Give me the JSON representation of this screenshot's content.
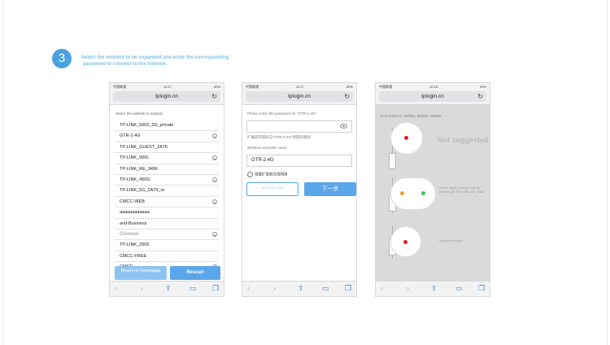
{
  "step": {
    "number": "3",
    "line1": "Select the network to be expanded and enter the corresponding",
    "line2": "password to connect to the internet."
  },
  "colors": {
    "accent": "#4aa3df",
    "button": "#5aa6ea",
    "led_red": "#e02020",
    "led_orange": "#f0a020",
    "led_green": "#3fbf4f"
  },
  "phones": [
    {
      "carrier": "中国联通",
      "time": "10:17",
      "battery": "60%",
      "url": "tplogin.cn",
      "label": "Select the website to expand",
      "networks": [
        {
          "name": "TP-LINK_5600_2G_private",
          "locked": false
        },
        {
          "name": "GTR-2.4G",
          "locked": true
        },
        {
          "name": "TP-LINK_GUEST_2A76",
          "locked": false
        },
        {
          "name": "TP-LINK_900L",
          "locked": true
        },
        {
          "name": "TP-LINK_RE_3456",
          "locked": false
        },
        {
          "name": "TP-LINK_450G",
          "locked": true
        },
        {
          "name": "TP-LINK_5G_2A76_re",
          "locked": false
        },
        {
          "name": "CMCC-WEB",
          "locked": true
        },
        {
          "name": "aaaaaaaaaaaa",
          "locked": false
        },
        {
          "name": "and-Business",
          "locked": false
        },
        {
          "name": "Chinese",
          "locked": true
        },
        {
          "name": "TP-LINK_2606",
          "locked": false
        },
        {
          "name": "CMCC-FREE",
          "locked": false
        },
        {
          "name": "CMCC",
          "locked": true
        }
      ],
      "return_button": "Return to homepage",
      "rescan_button": "Rescan"
    },
    {
      "carrier": "中国联通",
      "time": "10:17",
      "battery": "60%",
      "url": "tplogin.cn",
      "password_label": "Please enter the password for \"GTR-2.4G\"",
      "hint": "扩展前的密码与\"GTR-2.4G\"的密码相同",
      "name_label": "Wireless extender name",
      "name_value": "GTR-2.4G",
      "checkbox_label": "隐藏扩展器无线网络",
      "prev_button": "previous step",
      "next_button": "下一步"
    },
    {
      "carrier": "中国联通",
      "time": "10:18",
      "battery": "90%",
      "url": "tplogin.cn",
      "title": "Resolutions: 860Ma, 863Ma, 865Ma",
      "note1": "Not suggested",
      "note2": "Green light: Orange within and bright TP-LINK_RE_3456",
      "note3": "Signal strength"
    }
  ],
  "icons": [
    "reload-icon",
    "back-icon",
    "forward-icon",
    "share-icon",
    "bookmarks-icon",
    "tabs-icon",
    "lock-icon",
    "eye-icon"
  ]
}
